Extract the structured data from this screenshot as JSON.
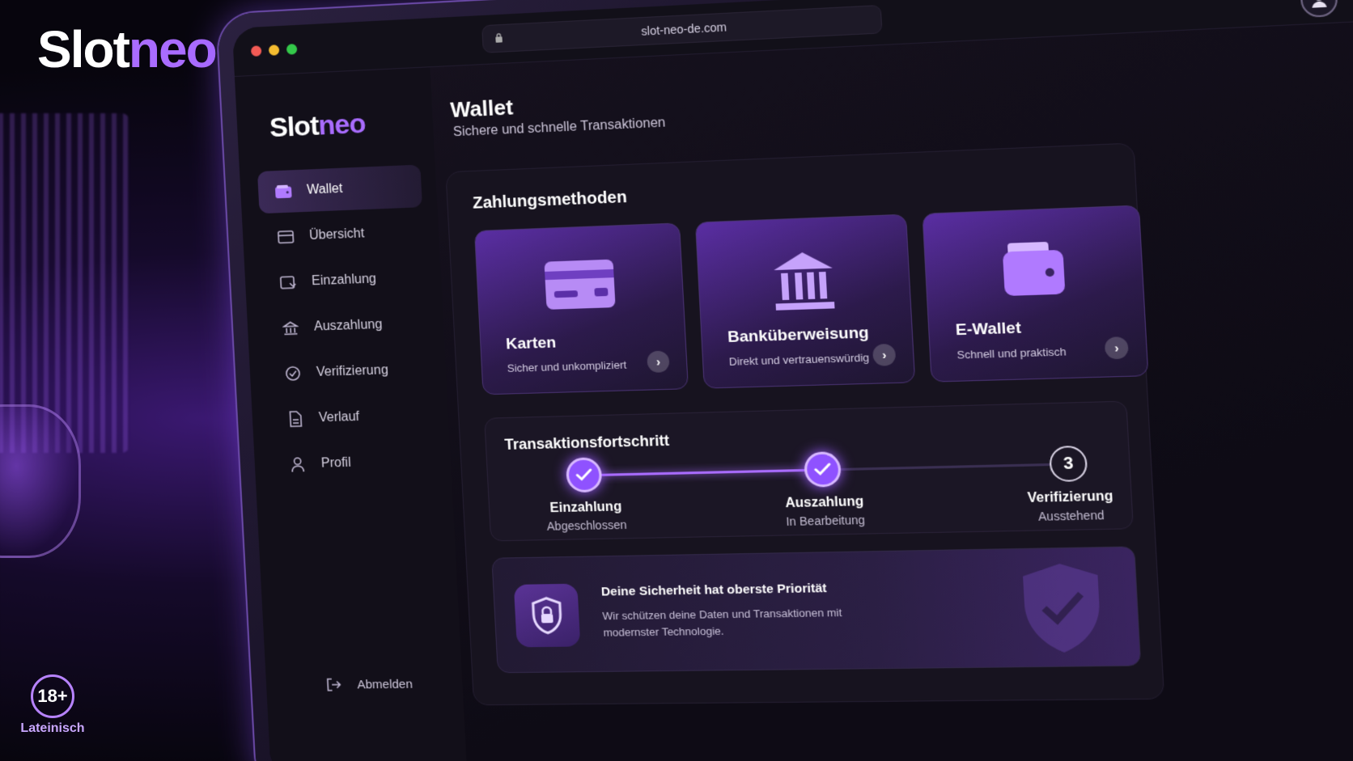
{
  "brand": {
    "part1": "Slot",
    "part2": "neo"
  },
  "age": {
    "badge": "18+",
    "label": "Lateinisch"
  },
  "browser": {
    "url": "slot-neo-de.com"
  },
  "sidebar": {
    "logo_part1": "Slot",
    "logo_part2": "neo",
    "items": [
      {
        "label": "Wallet",
        "icon": "wallet-icon",
        "active": true
      },
      {
        "label": "Übersicht",
        "icon": "overview-icon"
      },
      {
        "label": "Einzahlung",
        "icon": "deposit-icon"
      },
      {
        "label": "Auszahlung",
        "icon": "bank-icon"
      },
      {
        "label": "Verifizierung",
        "icon": "check-circle-icon"
      },
      {
        "label": "Verlauf",
        "icon": "document-icon"
      },
      {
        "label": "Profil",
        "icon": "user-icon"
      }
    ],
    "logout": "Abmelden"
  },
  "header": {
    "title": "Wallet",
    "subtitle": "Sichere und schnelle Transaktionen"
  },
  "payment": {
    "title": "Zahlungsmethoden",
    "cards": [
      {
        "title": "Karten",
        "subtitle": "Sicher und unkompliziert",
        "icon": "credit-card-icon"
      },
      {
        "title": "Banküberweisung",
        "subtitle": "Direkt und vertrauenswürdig",
        "icon": "bank-building-icon"
      },
      {
        "title": "E-Wallet",
        "subtitle": "Schnell und praktisch",
        "icon": "wallet-icon"
      }
    ]
  },
  "progress": {
    "title": "Transaktionsfortschritt",
    "completed_fraction": 0.5,
    "steps": [
      {
        "label": "Einzahlung",
        "status": "Abgeschlossen",
        "state": "done"
      },
      {
        "label": "Auszahlung",
        "status": "In Bearbeitung",
        "state": "done"
      },
      {
        "label": "Verifizierung",
        "status": "Ausstehend",
        "state": "pending",
        "number": "3"
      }
    ]
  },
  "security": {
    "title": "Deine Sicherheit hat oberste Priorität",
    "text": "Wir schützen deine Daten und Transaktionen mit modernster Technologie."
  },
  "colors": {
    "accent": "#a96cff",
    "background": "#0e0b15"
  }
}
